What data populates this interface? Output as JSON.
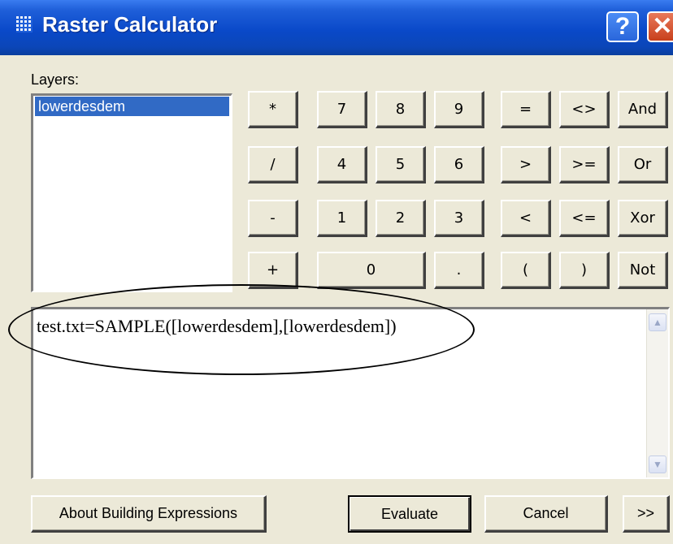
{
  "window": {
    "title": "Raster Calculator",
    "help_label": "?",
    "close_label": "✕"
  },
  "layers": {
    "label": "Layers:",
    "items": [
      "lowerdesdem"
    ],
    "selected": "lowerdesdem"
  },
  "keypad": {
    "multiply": "*",
    "divide": "/",
    "subtract": "-",
    "add": "+",
    "seven": "7",
    "eight": "8",
    "nine": "9",
    "four": "4",
    "five": "5",
    "six": "6",
    "one": "1",
    "two": "2",
    "three": "3",
    "zero": "0",
    "decimal": ".",
    "equals": "=",
    "not_equal": "<>",
    "and": "And",
    "greater": ">",
    "greater_equal": ">=",
    "or": "Or",
    "less": "<",
    "less_equal": "<=",
    "xor": "Xor",
    "open_paren": "(",
    "close_paren": ")",
    "not": "Not"
  },
  "expression": {
    "value": "test.txt=SAMPLE([lowerdesdem],[lowerdesdem])",
    "scroll_up": "▲",
    "scroll_down": "▼"
  },
  "buttons": {
    "about": "About Building Expressions",
    "evaluate": "Evaluate",
    "cancel": "Cancel",
    "more": ">>"
  }
}
